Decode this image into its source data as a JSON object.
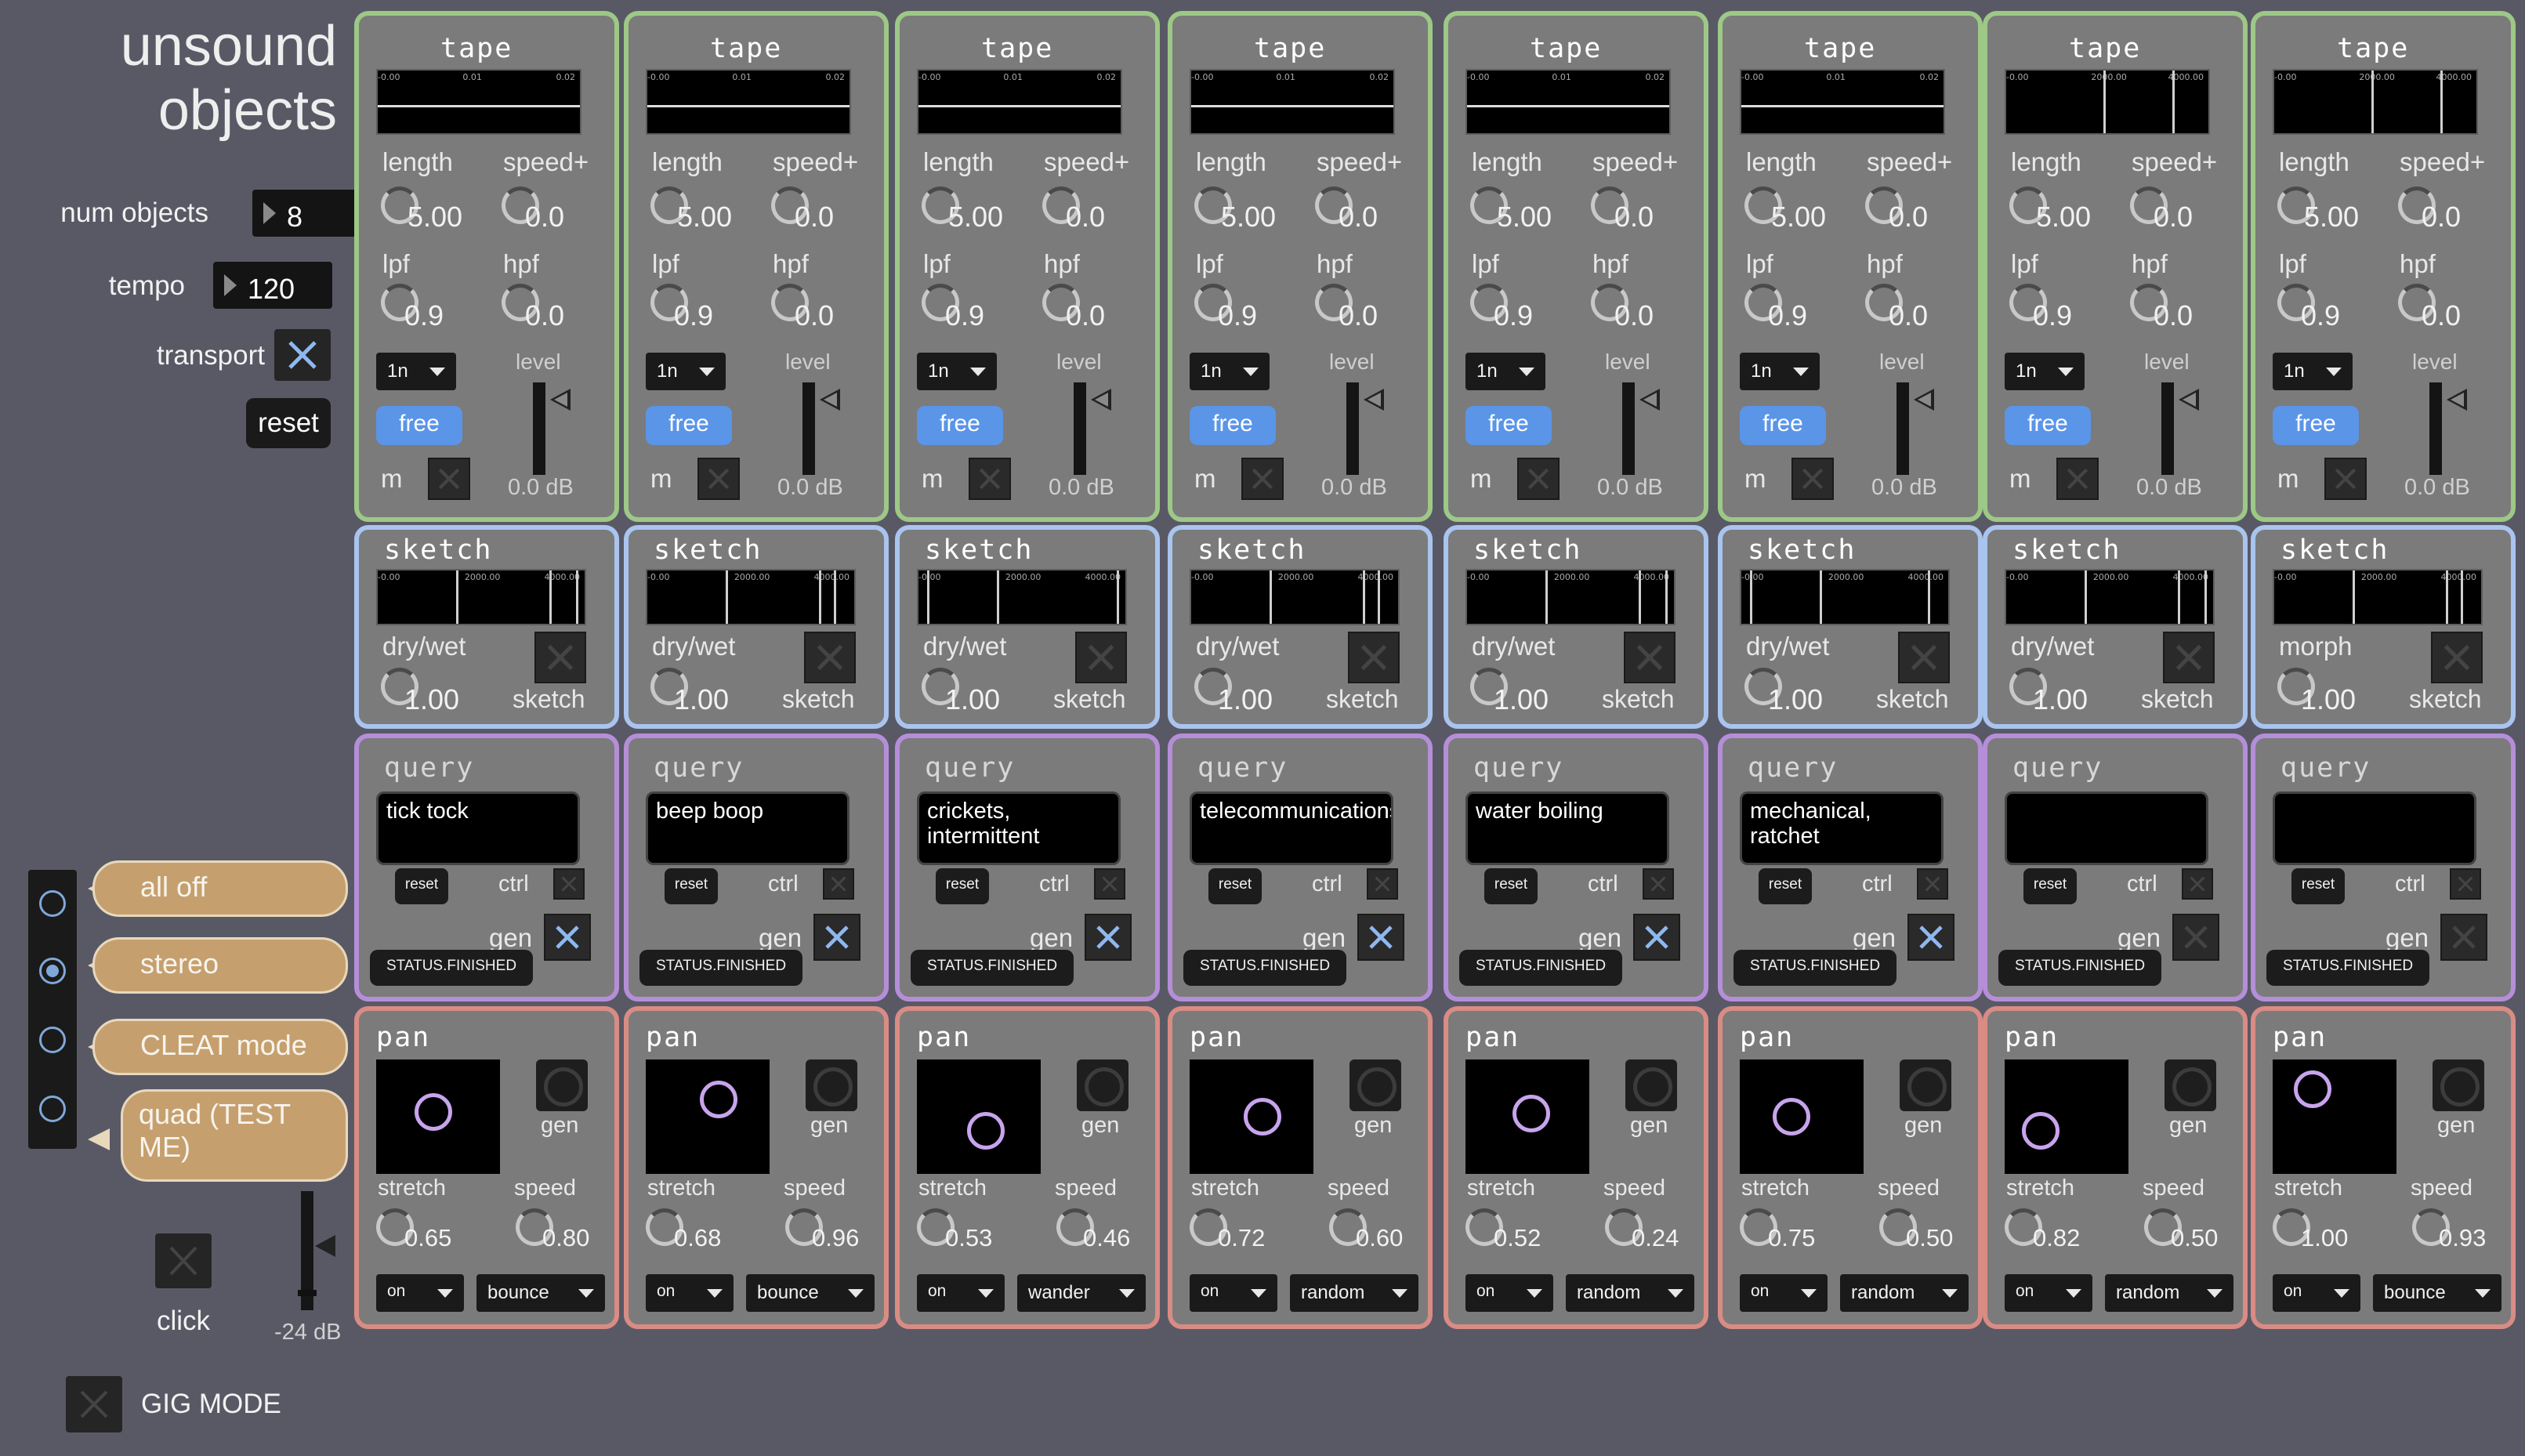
{
  "app": {
    "title_line1": "unsound",
    "title_line2": "objects"
  },
  "controls": {
    "num_objects_label": "num objects",
    "num_objects_value": "8",
    "tempo_label": "tempo",
    "tempo_value": "120",
    "transport_label": "transport",
    "transport_on": true,
    "reset_label": "reset"
  },
  "output_modes": {
    "options": [
      "all off",
      "stereo",
      "CLEAT mode",
      "quad (TEST ME)"
    ],
    "selected": "stereo"
  },
  "click": {
    "label": "click",
    "db": "-24 dB"
  },
  "gig_mode": {
    "label": "GIG MODE"
  },
  "colors": {
    "tape": "#9dc886",
    "sketch": "#a9c4ee",
    "query": "#b58ed8",
    "pan": "#d98c84",
    "free_button": "#5a95e8",
    "mode_bubble": "#c5a06e"
  },
  "objects": [
    {
      "tape": {
        "title": "tape",
        "scope_ticks": [
          "-0.00",
          "0.01",
          "0.02"
        ],
        "scope_style": "line",
        "length_label": "length",
        "length": "5.00",
        "speed_label": "speed+",
        "speed": "0.0",
        "lpf_label": "lpf",
        "lpf": "0.9",
        "hpf_label": "hpf",
        "hpf": "0.0",
        "rate": "1n",
        "free_label": "free",
        "level_label": "level",
        "m_label": "m",
        "db": "0.0 dB"
      },
      "sketch": {
        "title": "sketch",
        "scope_ticks": [
          "-0.00",
          "2000.00",
          "4000.00"
        ],
        "mix_label": "dry/wet",
        "mix": "1.00",
        "toggle_label": "sketch"
      },
      "query": {
        "title": "query",
        "text": "tick tock",
        "reset_label": "reset",
        "ctrl_label": "ctrl",
        "gen_label": "gen",
        "gen_on": true,
        "status": "STATUS.FINISHED"
      },
      "pan": {
        "title": "pan",
        "gen_label": "gen",
        "stretch_label": "stretch",
        "stretch": "0.65",
        "speed_label": "speed",
        "speed": "0.80",
        "state": "on",
        "mode": "bounce",
        "dot_x": 0.46,
        "dot_y": 0.46
      }
    },
    {
      "tape": {
        "title": "tape",
        "scope_ticks": [
          "-0.00",
          "0.01",
          "0.02"
        ],
        "scope_style": "line",
        "length_label": "length",
        "length": "5.00",
        "speed_label": "speed+",
        "speed": "0.0",
        "lpf_label": "lpf",
        "lpf": "0.9",
        "hpf_label": "hpf",
        "hpf": "0.0",
        "rate": "1n",
        "free_label": "free",
        "level_label": "level",
        "m_label": "m",
        "db": "0.0 dB"
      },
      "sketch": {
        "title": "sketch",
        "scope_ticks": [
          "-0.00",
          "2000.00",
          "4000.00"
        ],
        "mix_label": "dry/wet",
        "mix": "1.00",
        "toggle_label": "sketch"
      },
      "query": {
        "title": "query",
        "text": "beep boop",
        "reset_label": "reset",
        "ctrl_label": "ctrl",
        "gen_label": "gen",
        "gen_on": true,
        "status": "STATUS.FINISHED"
      },
      "pan": {
        "title": "pan",
        "gen_label": "gen",
        "stretch_label": "stretch",
        "stretch": "0.68",
        "speed_label": "speed",
        "speed": "0.96",
        "state": "on",
        "mode": "bounce",
        "dot_x": 0.59,
        "dot_y": 0.35
      }
    },
    {
      "tape": {
        "title": "tape",
        "scope_ticks": [
          "-0.00",
          "0.01",
          "0.02"
        ],
        "scope_style": "line",
        "length_label": "length",
        "length": "5.00",
        "speed_label": "speed+",
        "speed": "0.0",
        "lpf_label": "lpf",
        "lpf": "0.9",
        "hpf_label": "hpf",
        "hpf": "0.0",
        "rate": "1n",
        "free_label": "free",
        "level_label": "level",
        "m_label": "m",
        "db": "0.0 dB"
      },
      "sketch": {
        "title": "sketch",
        "scope_ticks": [
          "-0.00",
          "2000.00",
          "4000.00"
        ],
        "mix_label": "dry/wet",
        "mix": "1.00",
        "toggle_label": "sketch"
      },
      "query": {
        "title": "query",
        "text": "crickets, intermittent",
        "reset_label": "reset",
        "ctrl_label": "ctrl",
        "gen_label": "gen",
        "gen_on": true,
        "status": "STATUS.FINISHED"
      },
      "pan": {
        "title": "pan",
        "gen_label": "gen",
        "stretch_label": "stretch",
        "stretch": "0.53",
        "speed_label": "speed",
        "speed": "0.46",
        "state": "on",
        "mode": "wander",
        "dot_x": 0.56,
        "dot_y": 0.62
      }
    },
    {
      "tape": {
        "title": "tape",
        "scope_ticks": [
          "-0.00",
          "0.01",
          "0.02"
        ],
        "scope_style": "line",
        "length_label": "length",
        "length": "5.00",
        "speed_label": "speed+",
        "speed": "0.0",
        "lpf_label": "lpf",
        "lpf": "0.9",
        "hpf_label": "hpf",
        "hpf": "0.0",
        "rate": "1n",
        "free_label": "free",
        "level_label": "level",
        "m_label": "m",
        "db": "0.0 dB"
      },
      "sketch": {
        "title": "sketch",
        "scope_ticks": [
          "-0.00",
          "2000.00",
          "4000.00"
        ],
        "mix_label": "dry/wet",
        "mix": "1.00",
        "toggle_label": "sketch"
      },
      "query": {
        "title": "query",
        "text": "telecommunications",
        "reset_label": "reset",
        "ctrl_label": "ctrl",
        "gen_label": "gen",
        "gen_on": true,
        "status": "STATUS.FINISHED"
      },
      "pan": {
        "title": "pan",
        "gen_label": "gen",
        "stretch_label": "stretch",
        "stretch": "0.72",
        "speed_label": "speed",
        "speed": "0.60",
        "state": "on",
        "mode": "random",
        "dot_x": 0.59,
        "dot_y": 0.5
      }
    },
    {
      "tape": {
        "title": "tape",
        "scope_ticks": [
          "-0.00",
          "0.01",
          "0.02"
        ],
        "scope_style": "line",
        "length_label": "length",
        "length": "5.00",
        "speed_label": "speed+",
        "speed": "0.0",
        "lpf_label": "lpf",
        "lpf": "0.9",
        "hpf_label": "hpf",
        "hpf": "0.0",
        "rate": "1n",
        "free_label": "free",
        "level_label": "level",
        "m_label": "m",
        "db": "0.0 dB"
      },
      "sketch": {
        "title": "sketch",
        "scope_ticks": [
          "-0.00",
          "2000.00",
          "4000.00"
        ],
        "mix_label": "dry/wet",
        "mix": "1.00",
        "toggle_label": "sketch"
      },
      "query": {
        "title": "query",
        "text": "water boiling",
        "reset_label": "reset",
        "ctrl_label": "ctrl",
        "gen_label": "gen",
        "gen_on": true,
        "status": "STATUS.FINISHED"
      },
      "pan": {
        "title": "pan",
        "gen_label": "gen",
        "stretch_label": "stretch",
        "stretch": "0.52",
        "speed_label": "speed",
        "speed": "0.24",
        "state": "on",
        "mode": "random",
        "dot_x": 0.53,
        "dot_y": 0.47
      }
    },
    {
      "tape": {
        "title": "tape",
        "scope_ticks": [
          "-0.00",
          "0.01",
          "0.02"
        ],
        "scope_style": "line",
        "length_label": "length",
        "length": "5.00",
        "speed_label": "speed+",
        "speed": "0.0",
        "lpf_label": "lpf",
        "lpf": "0.9",
        "hpf_label": "hpf",
        "hpf": "0.0",
        "rate": "1n",
        "free_label": "free",
        "level_label": "level",
        "m_label": "m",
        "db": "0.0 dB"
      },
      "sketch": {
        "title": "sketch",
        "scope_ticks": [
          "-0.00",
          "2000.00",
          "4000.00"
        ],
        "mix_label": "dry/wet",
        "mix": "1.00",
        "toggle_label": "sketch"
      },
      "query": {
        "title": "query",
        "text": "mechanical, ratchet",
        "reset_label": "reset",
        "ctrl_label": "ctrl",
        "gen_label": "gen",
        "gen_on": true,
        "status": "STATUS.FINISHED"
      },
      "pan": {
        "title": "pan",
        "gen_label": "gen",
        "stretch_label": "stretch",
        "stretch": "0.75",
        "speed_label": "speed",
        "speed": "0.50",
        "state": "on",
        "mode": "random",
        "dot_x": 0.42,
        "dot_y": 0.5
      }
    },
    {
      "tape": {
        "title": "tape",
        "scope_ticks": [
          "-0.00",
          "2000.00",
          "4000.00"
        ],
        "scope_style": "bars",
        "length_label": "length",
        "length": "5.00",
        "speed_label": "speed+",
        "speed": "0.0",
        "lpf_label": "lpf",
        "lpf": "0.9",
        "hpf_label": "hpf",
        "hpf": "0.0",
        "rate": "1n",
        "free_label": "free",
        "level_label": "level",
        "m_label": "m",
        "db": "0.0 dB"
      },
      "sketch": {
        "title": "sketch",
        "scope_ticks": [
          "-0.00",
          "2000.00",
          "4000.00"
        ],
        "mix_label": "dry/wet",
        "mix": "1.00",
        "toggle_label": "sketch"
      },
      "query": {
        "title": "query",
        "text": "",
        "reset_label": "reset",
        "ctrl_label": "ctrl",
        "gen_label": "gen",
        "gen_on": false,
        "status": "STATUS.FINISHED"
      },
      "pan": {
        "title": "pan",
        "gen_label": "gen",
        "stretch_label": "stretch",
        "stretch": "0.82",
        "speed_label": "speed",
        "speed": "0.50",
        "state": "on",
        "mode": "random",
        "dot_x": 0.29,
        "dot_y": 0.62
      }
    },
    {
      "tape": {
        "title": "tape",
        "scope_ticks": [
          "-0.00",
          "2000.00",
          "4000.00"
        ],
        "scope_style": "bars",
        "length_label": "length",
        "length": "5.00",
        "speed_label": "speed+",
        "speed": "0.0",
        "lpf_label": "lpf",
        "lpf": "0.9",
        "hpf_label": "hpf",
        "hpf": "0.0",
        "rate": "1n",
        "free_label": "free",
        "level_label": "level",
        "m_label": "m",
        "db": "0.0 dB"
      },
      "sketch": {
        "title": "sketch",
        "scope_ticks": [
          "-0.00",
          "2000.00",
          "4000.00"
        ],
        "mix_label": "morph",
        "mix": "1.00",
        "toggle_label": "sketch"
      },
      "query": {
        "title": "query",
        "text": "",
        "reset_label": "reset",
        "ctrl_label": "ctrl",
        "gen_label": "gen",
        "gen_on": false,
        "status": "STATUS.FINISHED"
      },
      "pan": {
        "title": "pan",
        "gen_label": "gen",
        "stretch_label": "stretch",
        "stretch": "1.00",
        "speed_label": "speed",
        "speed": "0.93",
        "state": "on",
        "mode": "bounce",
        "dot_x": 0.32,
        "dot_y": 0.26
      }
    }
  ]
}
